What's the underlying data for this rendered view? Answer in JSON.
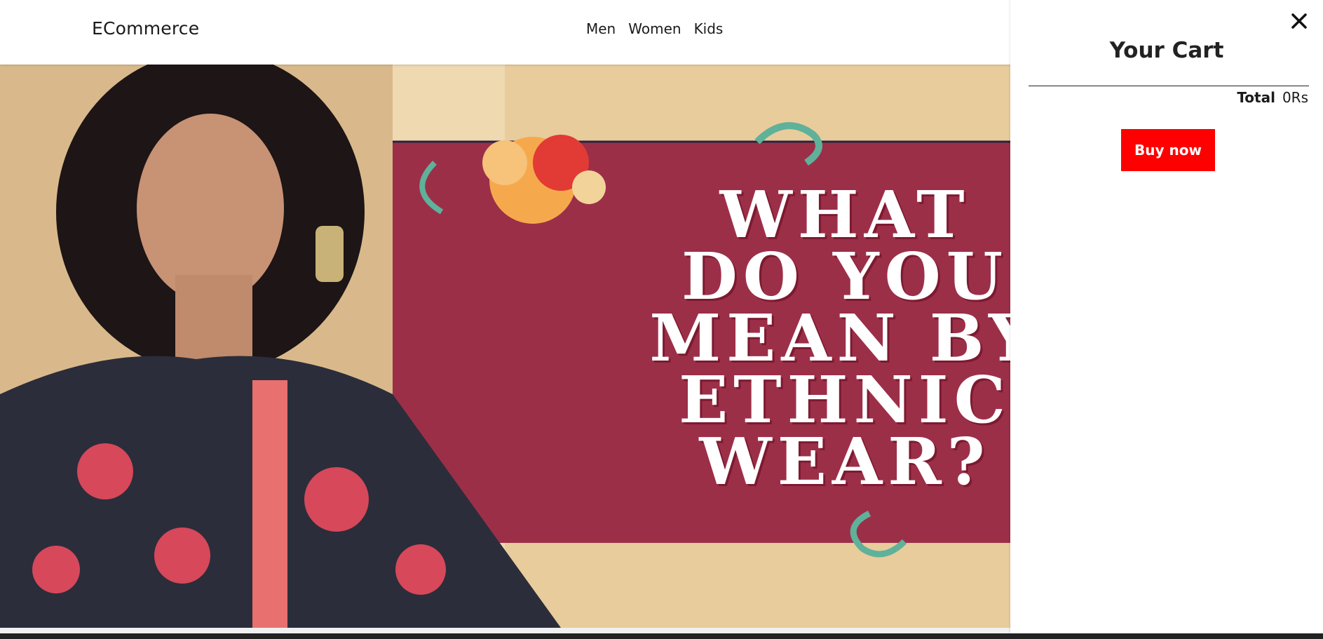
{
  "navbar": {
    "brand": "ECommerce",
    "links": [
      "Men",
      "Women",
      "Kids"
    ]
  },
  "hero": {
    "banner_text": "WHAT\nDO YOU\nMEAN BY\nETHNIC\nWEAR?",
    "colors": {
      "banner": "#9c2f48",
      "background": "#e8cc9c"
    }
  },
  "cart": {
    "title": "Your Cart",
    "total_label": "Total",
    "total_value": "0Rs",
    "buy_label": "Buy now",
    "close_icon": "close-icon",
    "accent": "#ff0000"
  }
}
